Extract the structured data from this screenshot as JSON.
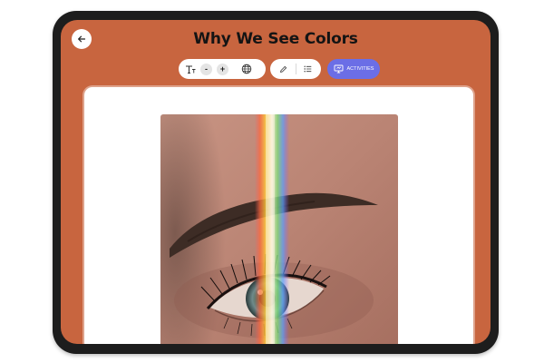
{
  "header": {
    "title": "Why We See Colors"
  },
  "toolbar": {
    "decrease_label": "-",
    "increase_label": "+",
    "activities_label": "ACTIVITIES"
  },
  "icons": {
    "back": "arrow-left-icon",
    "text_size": "text-size-icon",
    "language": "globe-icon",
    "highlight": "pencil-icon",
    "list": "list-icon",
    "activities": "presentation-icon"
  },
  "colors": {
    "screen_background": "#c8653f",
    "activities_button": "#6b6ee6",
    "bezel": "#1d1d1d"
  },
  "image": {
    "subject": "eye-with-rainbow-light"
  }
}
